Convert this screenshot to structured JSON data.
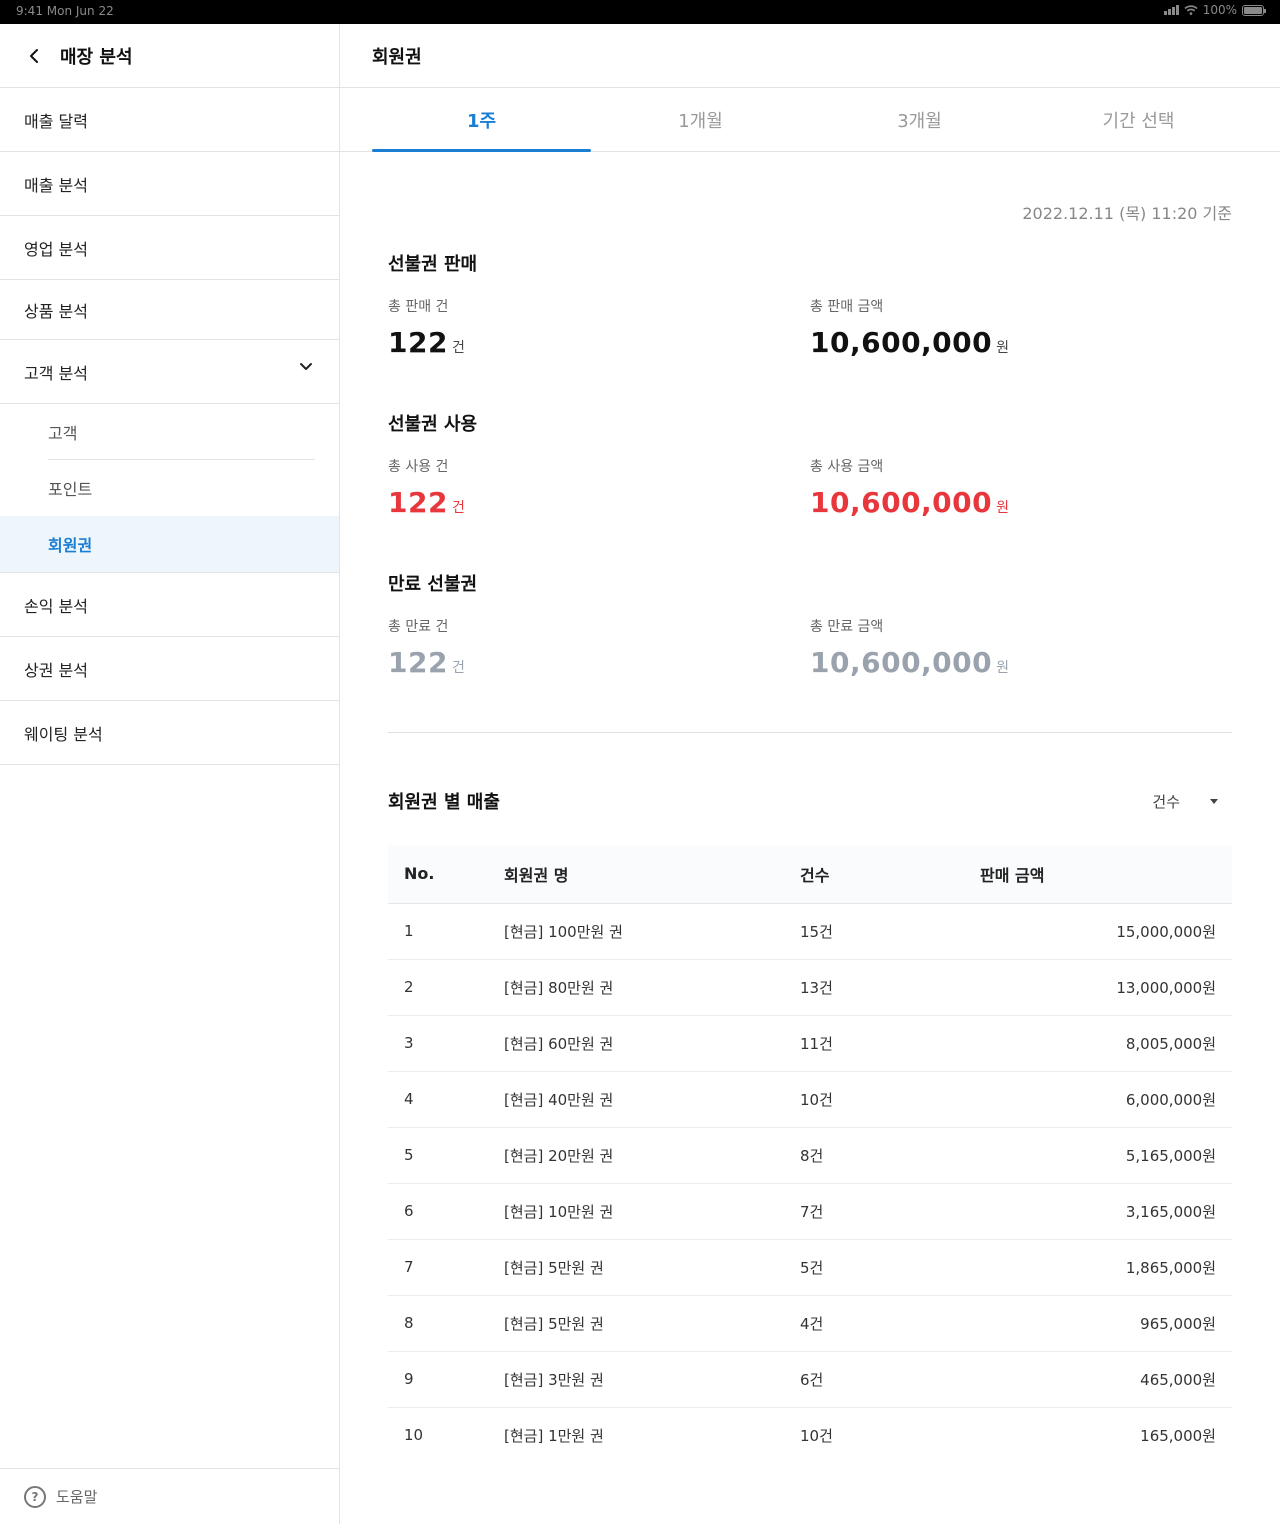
{
  "status_bar": {
    "time": "9:41  Mon Jun 22",
    "battery": "100%"
  },
  "sidebar": {
    "title": "매장 분석",
    "items_top": [
      {
        "label": "매출 달력"
      },
      {
        "label": "매출 분석"
      },
      {
        "label": "영업 분석"
      },
      {
        "label": "상품 분석"
      }
    ],
    "expanded": {
      "label": "고객 분석"
    },
    "sub_items": [
      {
        "label": "고객"
      },
      {
        "label": "포인트"
      }
    ],
    "sub_active": {
      "label": "회원권"
    },
    "items_bottom": [
      {
        "label": "손익 분석"
      },
      {
        "label": "상권 분석"
      },
      {
        "label": "웨이팅 분석"
      }
    ],
    "help": "도움말"
  },
  "main": {
    "title": "회원권",
    "tabs": [
      {
        "label": "1주",
        "active": true
      },
      {
        "label": "1개월"
      },
      {
        "label": "3개월"
      },
      {
        "label": "기간 선택"
      }
    ],
    "as_of": "2022.12.11 (목) 11:20 기준",
    "sale": {
      "title": "선불권 판매",
      "count_label": "총 판매 건",
      "count": "122",
      "count_unit": "건",
      "amount_label": "총 판매 금액",
      "amount": "10,600,000",
      "amount_unit": "원"
    },
    "use": {
      "title": "선불권 사용",
      "count_label": "총 사용 건",
      "count": "122",
      "count_unit": "건",
      "amount_label": "총 사용 금액",
      "amount": "10,600,000",
      "amount_unit": "원"
    },
    "expire": {
      "title": "만료 선불권",
      "count_label": "총 만료 건",
      "count": "122",
      "count_unit": "건",
      "amount_label": "총 만료 금액",
      "amount": "10,600,000",
      "amount_unit": "원"
    },
    "list": {
      "title": "회원권 별 매출",
      "sort_label": "건수",
      "headers": [
        "No.",
        "회원권 명",
        "건수",
        "판매 금액"
      ],
      "rows": [
        [
          "1",
          "[현금] 100만원 권",
          "15건",
          "15,000,000원"
        ],
        [
          "2",
          "[현금] 80만원 권",
          "13건",
          "13,000,000원"
        ],
        [
          "3",
          "[현금] 60만원 권",
          "11건",
          "8,005,000원"
        ],
        [
          "4",
          "[현금] 40만원 권",
          "10건",
          "6,000,000원"
        ],
        [
          "5",
          "[현금] 20만원 권",
          "8건",
          "5,165,000원"
        ],
        [
          "6",
          "[현금] 10만원 권",
          "7건",
          "3,165,000원"
        ],
        [
          "7",
          "[현금] 5만원 권",
          "5건",
          "1,865,000원"
        ],
        [
          "8",
          "[현금] 5만원 권",
          "4건",
          "965,000원"
        ],
        [
          "9",
          "[현금] 3만원 권",
          "6건",
          "465,000원"
        ],
        [
          "10",
          "[현금] 1만원 권",
          "10건",
          "165,000원"
        ]
      ]
    }
  },
  "colors": {
    "accent": "#1a7fd3",
    "red": "#e8363d",
    "muted": "#9aa3ad"
  }
}
